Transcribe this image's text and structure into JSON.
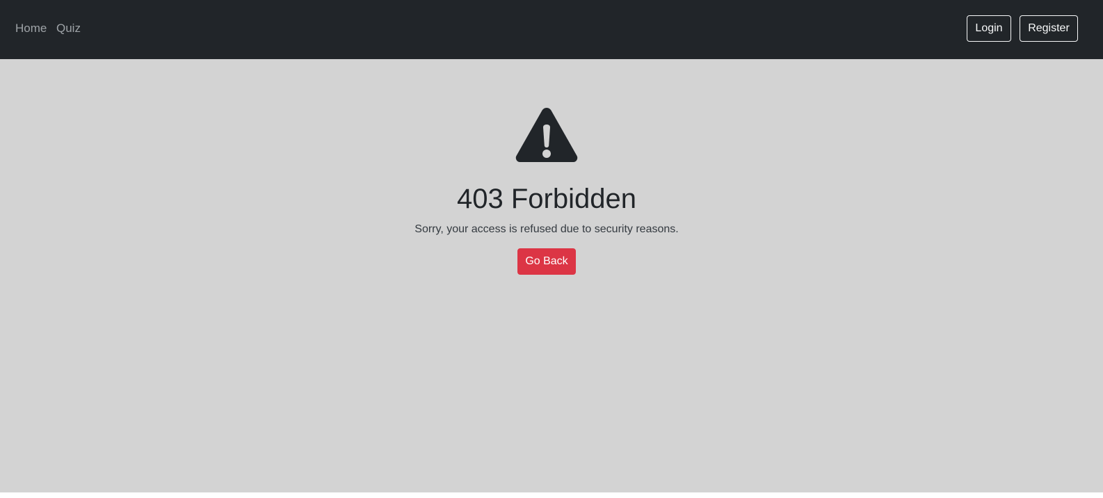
{
  "navbar": {
    "links": [
      {
        "label": "Home"
      },
      {
        "label": "Quiz"
      }
    ],
    "login_label": "Login",
    "register_label": "Register",
    "background_color": "#212529"
  },
  "error": {
    "icon": "warning-triangle-icon",
    "title": "403 Forbidden",
    "message": "Sorry, your access is refused due to security reasons.",
    "button_label": "Go Back",
    "button_color": "#dc3545",
    "background_color": "#d3d3d3"
  }
}
